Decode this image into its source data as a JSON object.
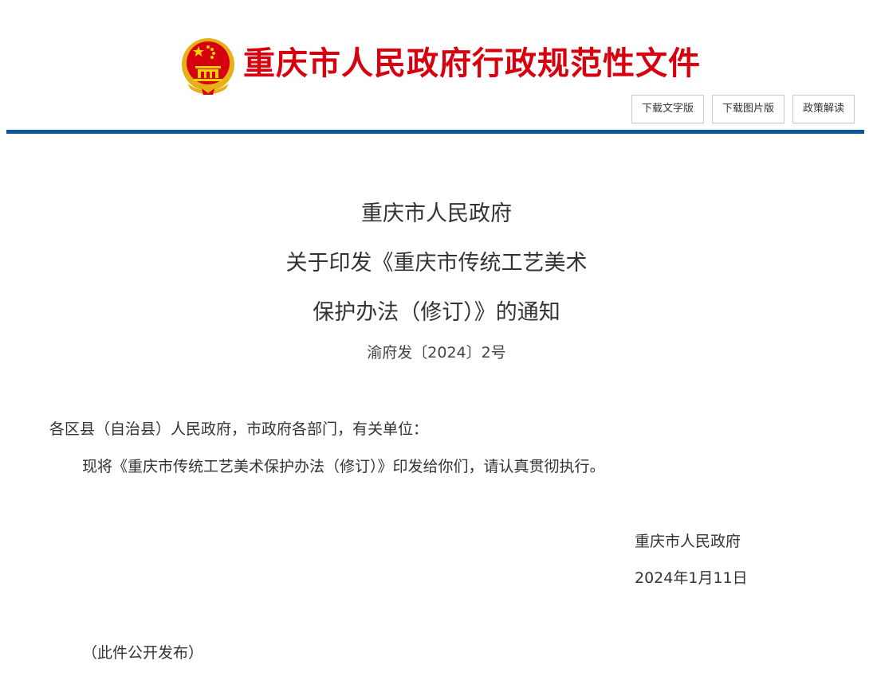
{
  "header": {
    "masthead": "重庆市人民政府行政规范性文件",
    "emblem_icon": "national-emblem-icon",
    "buttons": {
      "download_text": "下载文字版",
      "download_image": "下载图片版",
      "policy_reading": "政策解读"
    },
    "rule_color": "#0e5796",
    "accent_color": "#d7000f"
  },
  "document": {
    "title_lines": [
      "重庆市人民政府",
      "关于印发《重庆市传统工艺美术",
      "保护办法（修订）》的通知"
    ],
    "doc_number": "渝府发〔2024〕2号",
    "salutation": "各区县（自治县）人民政府，市政府各部门，有关单位：",
    "body": "现将《重庆市传统工艺美术保护办法（修订）》印发给你们，请认真贯彻执行。",
    "signature": "重庆市人民政府",
    "date": "2024年1月11日",
    "note": "（此件公开发布）"
  }
}
